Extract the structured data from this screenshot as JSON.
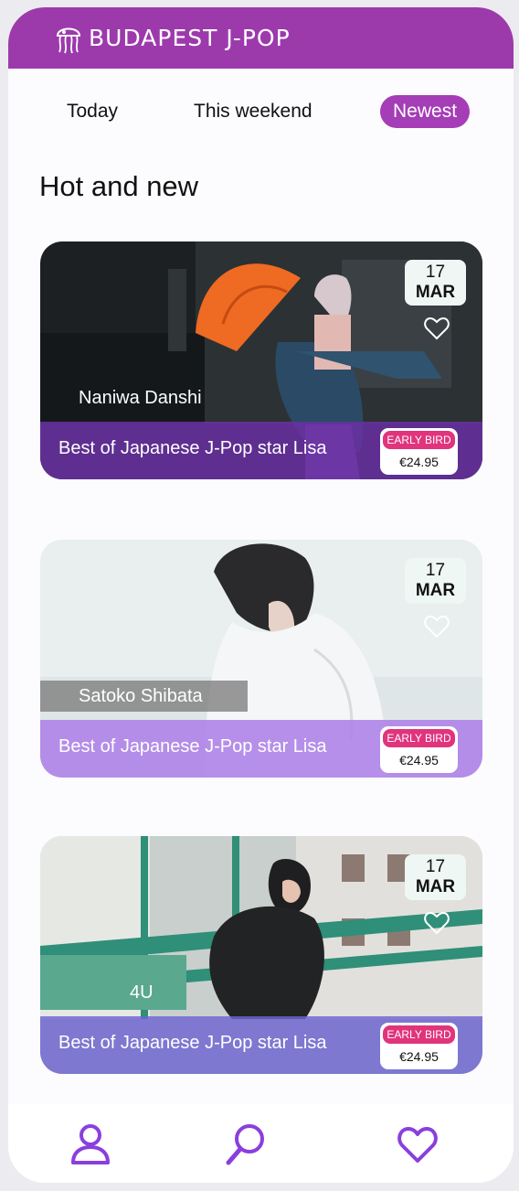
{
  "app": {
    "title": "BUDAPEST J-POP",
    "logo_icon": "jellyfish-icon",
    "brand_color": "#9c3aac"
  },
  "tabs": [
    {
      "label": "Today",
      "active": false
    },
    {
      "label": "This weekend",
      "active": false
    },
    {
      "label": "Newest",
      "active": true
    }
  ],
  "section": {
    "title": "Hot and new"
  },
  "events": [
    {
      "artist": "Naniwa Danshi",
      "title": "Best of Japanese J-Pop star Lisa",
      "day": "17",
      "month": "MAR",
      "badge": "EARLY BIRD",
      "price": "€24.95"
    },
    {
      "artist": "Satoko Shibata",
      "title": "Best of Japanese J-Pop star Lisa",
      "day": "17",
      "month": "MAR",
      "badge": "EARLY BIRD",
      "price": "€24.95"
    },
    {
      "artist": "4U",
      "title": "Best of Japanese J-Pop star Lisa",
      "day": "17",
      "month": "MAR",
      "badge": "EARLY BIRD",
      "price": "€24.95"
    }
  ],
  "nav": {
    "items": [
      {
        "icon": "profile-icon"
      },
      {
        "icon": "search-icon"
      },
      {
        "icon": "heart-icon"
      }
    ],
    "icon_color": "#8a3fdc"
  }
}
